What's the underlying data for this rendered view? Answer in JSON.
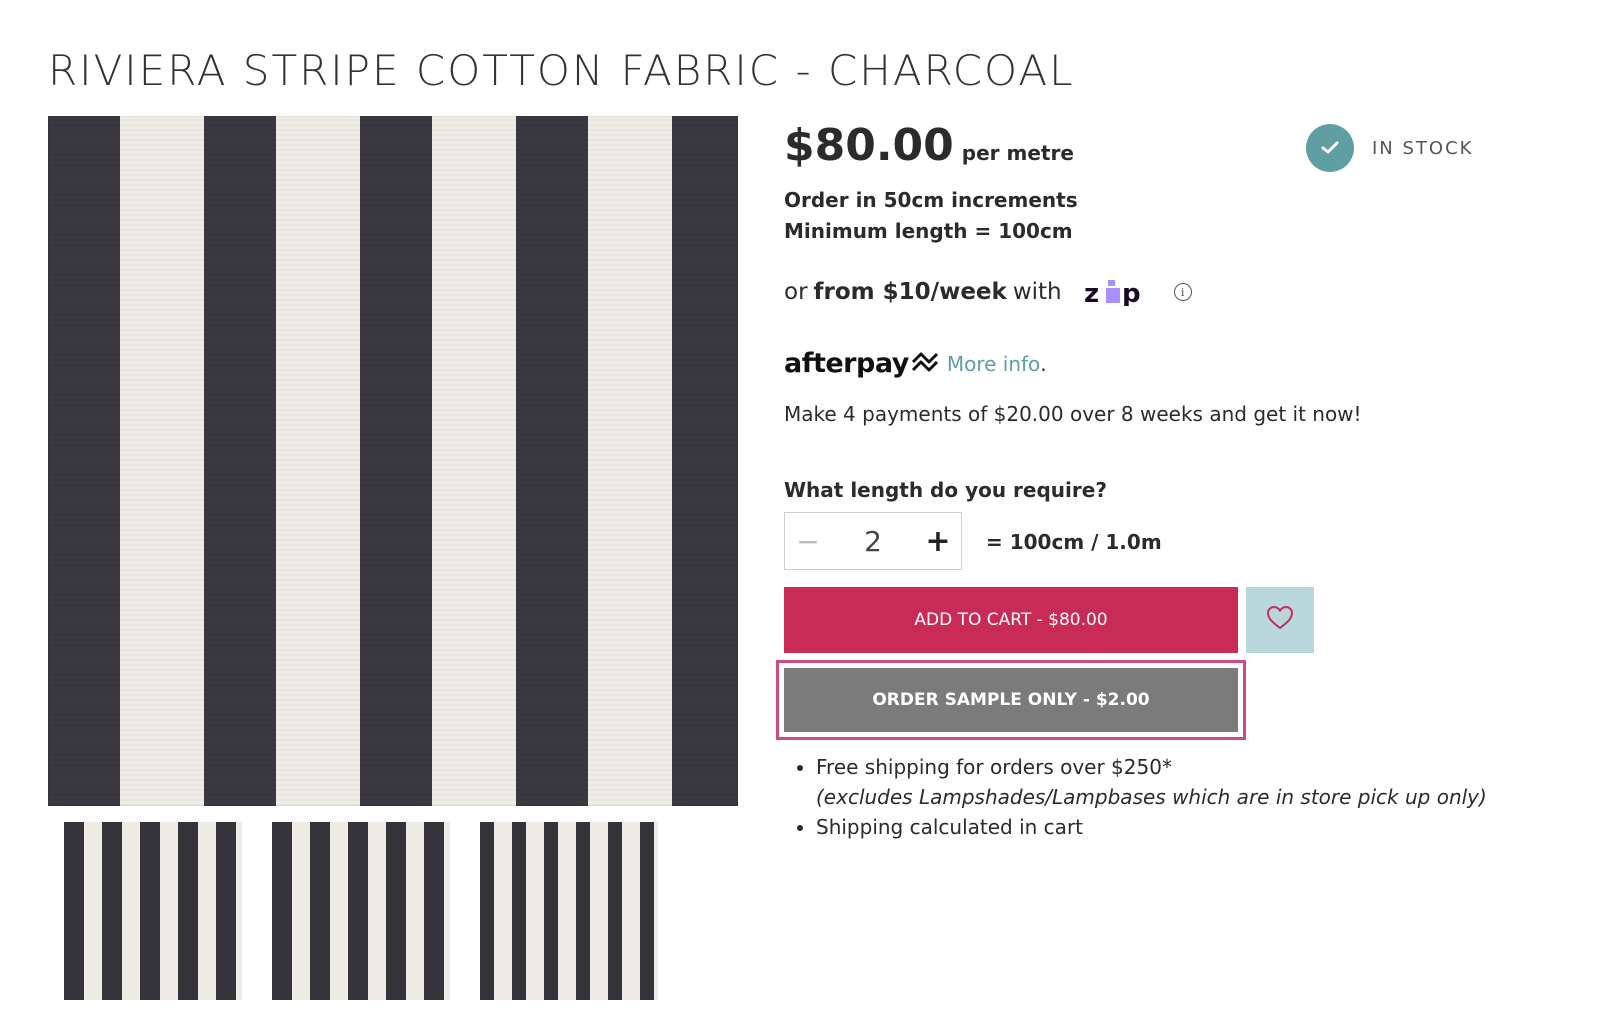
{
  "product": {
    "title": "RIVIERA STRIPE COTTON FABRIC - CHARCOAL",
    "price": "$80.00",
    "price_unit": "per metre",
    "stock_status": "IN STOCK",
    "order_increment": "Order in 50cm increments",
    "minimum_length": "Minimum length = 100cm"
  },
  "zip": {
    "prefix": "or",
    "amount": "from $10/week",
    "suffix": "with",
    "logo_text": "zip",
    "info_icon": "info-icon"
  },
  "afterpay": {
    "logo_text": "afterpay",
    "link": "More info",
    "period": ".",
    "message": "Make 4 payments of $20.00 over 8 weeks and get it now!"
  },
  "length": {
    "question": "What length do you require?",
    "quantity": "2",
    "minus": "−",
    "plus": "+",
    "equivalent": "= 100cm / 1.0m"
  },
  "actions": {
    "add_to_cart": "ADD TO CART - $80.00",
    "wishlist_icon": "heart-icon",
    "order_sample": "ORDER SAMPLE ONLY - $2.00"
  },
  "shipping": {
    "free_shipping": "Free shipping for orders over $250*",
    "exclusion": "(excludes Lampshades/Lampbases which are in store pick up only)",
    "calculated": "Shipping calculated in cart"
  },
  "colors": {
    "accent_teal": "#5f9ea2",
    "cart_red": "#c82b55",
    "sample_grey": "#7b7b7b",
    "highlight_pink": "#d04a86"
  }
}
